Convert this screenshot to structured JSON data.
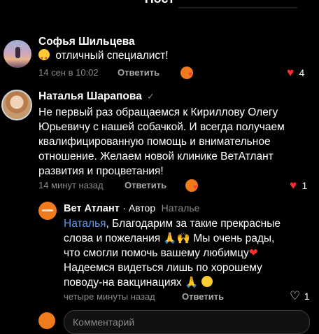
{
  "header": {
    "title": "Пост"
  },
  "comments": [
    {
      "author": "Софья Шильцева",
      "text": "отличный специалист!",
      "time": "14 сен в 10:02",
      "reply_label": "Ответить",
      "likes": "4",
      "liked": true
    },
    {
      "author": "Наталья Шарапова",
      "verified_mark": "✓",
      "text_lines": [
        "Не первый раз обращаемся к Кириллову Олегу",
        "Юрьевичу с нашей собачкой. И всегда получаем",
        "квалифицированную помощь и внимательное",
        "отношение. Желаем новой клинике ВетАтлант",
        "развития и процветания!"
      ],
      "time": "14 минут назад",
      "reply_label": "Ответить",
      "likes": "1",
      "liked": true
    }
  ],
  "reply": {
    "author": "Вет Атлант",
    "role": "· Автор",
    "to": "Наталье",
    "mention": "Наталья",
    "line1_rest": ", Благодарим за такие прекрасные",
    "line2": "слова и пожелания 🙏🙌 Мы очень рады,",
    "line3": "что смогли помочь вашему любимцу",
    "line4": "Надеемся видеться лишь по хорошему",
    "line5": "поводу-на вакцинациях",
    "time": "четыре минуты назад",
    "reply_label": "Ответить",
    "likes": "1",
    "liked": false
  },
  "input": {
    "placeholder": "Комментарий"
  },
  "colors": {
    "accent_link": "#5a9bf2",
    "heart": "#ff2d2d",
    "brand": "#f07b1d"
  },
  "icons": {
    "heart": "heart-icon",
    "heart_outline": "heart-outline-icon",
    "verified": "verified-icon",
    "reaction": "reaction-icon"
  }
}
